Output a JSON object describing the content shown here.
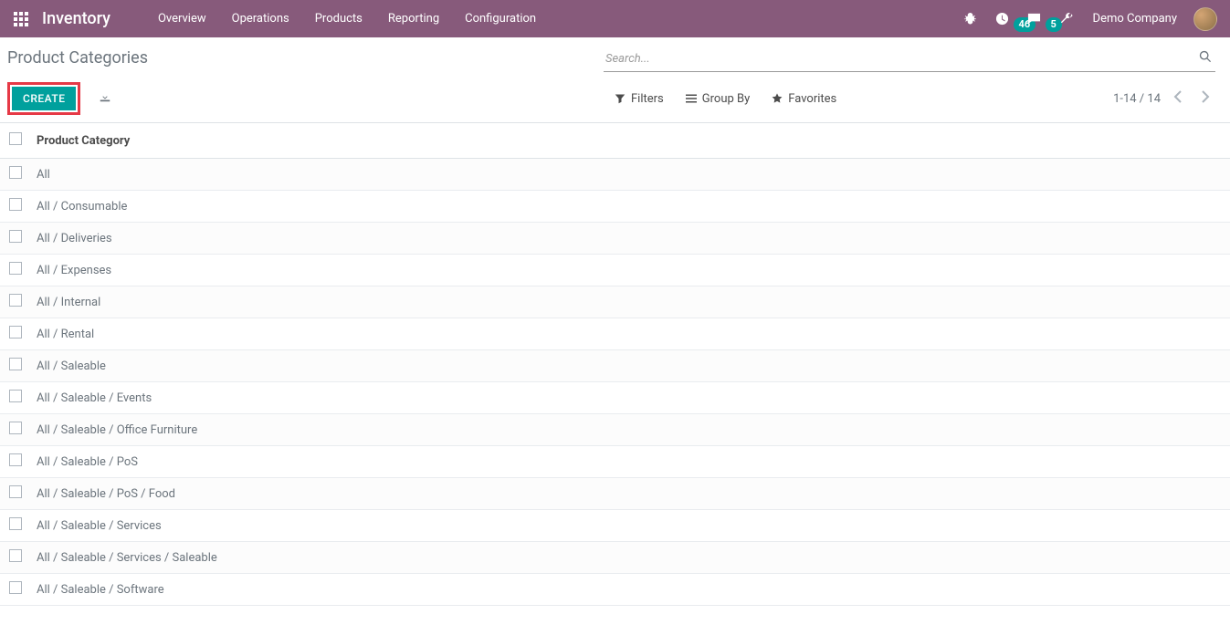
{
  "navbar": {
    "brand": "Inventory",
    "menu": [
      "Overview",
      "Operations",
      "Products",
      "Reporting",
      "Configuration"
    ],
    "activity_badge": "46",
    "messaging_badge": "5",
    "company": "Demo Company"
  },
  "breadcrumb": "Product Categories",
  "toolbar": {
    "create_label": "CREATE",
    "filters_label": "Filters",
    "groupby_label": "Group By",
    "favorites_label": "Favorites",
    "pager_text": "1-14 / 14"
  },
  "search": {
    "placeholder": "Search..."
  },
  "table": {
    "header": "Product Category",
    "rows": [
      "All",
      "All / Consumable",
      "All / Deliveries",
      "All / Expenses",
      "All / Internal",
      "All / Rental",
      "All / Saleable",
      "All / Saleable / Events",
      "All / Saleable / Office Furniture",
      "All / Saleable / PoS",
      "All / Saleable / PoS / Food",
      "All / Saleable / Services",
      "All / Saleable / Services / Saleable",
      "All / Saleable / Software"
    ]
  }
}
